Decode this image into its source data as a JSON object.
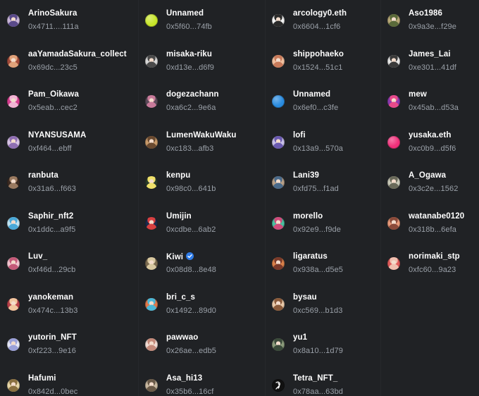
{
  "columns": [
    [
      {
        "name": "ArinoSakura",
        "address": "0x4711....111a",
        "avatar": {
          "icon": "anime-avatar-icon",
          "color": "#c9b6d8",
          "accent": "#5a4a8a"
        }
      },
      {
        "name": "aaYamadaSakura_collect",
        "address": "0x69dc...23c5",
        "avatar": {
          "icon": "anime-avatar-icon",
          "color": "#a14a3a",
          "accent": "#e0a27a"
        }
      },
      {
        "name": "Pam_Oikawa",
        "address": "0x5eab...cec2",
        "avatar": {
          "icon": "anime-avatar-icon",
          "color": "#d63c8f",
          "accent": "#f2b4d4"
        }
      },
      {
        "name": "NYANSUSAMA",
        "address": "0xf464...ebff",
        "avatar": {
          "icon": "anime-avatar-icon",
          "color": "#d8c4e6",
          "accent": "#8f6fb2"
        }
      },
      {
        "name": "ranbuta",
        "address": "0x31a6...f663",
        "avatar": {
          "icon": "anime-avatar-icon",
          "color": "#3a2a22",
          "accent": "#9a7a60"
        }
      },
      {
        "name": "Saphir_nft2",
        "address": "0x1ddc...a9f5",
        "avatar": {
          "icon": "anime-avatar-icon",
          "color": "#bfe4f4",
          "accent": "#4aa8d8"
        }
      },
      {
        "name": "Luv_",
        "address": "0xf46d...29cb",
        "avatar": {
          "icon": "anime-avatar-icon",
          "color": "#f2c4cf",
          "accent": "#c45a78"
        }
      },
      {
        "name": "yanokeman",
        "address": "0x474c...13b3",
        "avatar": {
          "icon": "anime-avatar-icon",
          "color": "#b8404a",
          "accent": "#f1c7a0"
        }
      },
      {
        "name": "yutorin_NFT",
        "address": "0xf223...9e16",
        "avatar": {
          "icon": "anime-avatar-icon",
          "color": "#e6e8f8",
          "accent": "#9aa0d8"
        }
      },
      {
        "name": "Hafumi",
        "address": "0x842d...0bec",
        "avatar": {
          "icon": "anime-avatar-icon",
          "color": "#e8d7a8",
          "accent": "#8a7040"
        }
      }
    ],
    [
      {
        "name": "Unnamed",
        "address": "0x5f60...74fb",
        "avatar": {
          "icon": "default-avatar-icon",
          "color": "#c8e62a",
          "accent": "#a7c81c"
        }
      },
      {
        "name": "misaka-riku",
        "address": "0xd13e...d6f9",
        "avatar": {
          "icon": "anime-avatar-icon",
          "color": "#d8d8d8",
          "accent": "#4a4a4a"
        }
      },
      {
        "name": "dogezachann",
        "address": "0xa6c2...9e6a",
        "avatar": {
          "icon": "anime-avatar-icon",
          "color": "#5a4a58",
          "accent": "#c87a9a"
        }
      },
      {
        "name": "LumenWakuWaku",
        "address": "0xc183...afb3",
        "avatar": {
          "icon": "anime-avatar-icon",
          "color": "#c89a6a",
          "accent": "#6a4a30"
        }
      },
      {
        "name": "kenpu",
        "address": "0x98c0...641b",
        "avatar": {
          "icon": "anime-avatar-icon",
          "color": "#2a3a2a",
          "accent": "#f0e06a"
        }
      },
      {
        "name": "Umijin",
        "address": "0xcdbe...6ab2",
        "avatar": {
          "icon": "anime-avatar-icon",
          "color": "#1a2a4a",
          "accent": "#d84040"
        }
      },
      {
        "name": "Kiwi",
        "address": "0x08d8...8e48",
        "verified": true,
        "avatar": {
          "icon": "anime-avatar-icon",
          "color": "#7a6a50",
          "accent": "#d8c8a0"
        }
      },
      {
        "name": "bri_c_s",
        "address": "0x1492...89d0",
        "avatar": {
          "icon": "anime-avatar-icon",
          "color": "#e0784a",
          "accent": "#4ab8d8"
        }
      },
      {
        "name": "pawwao",
        "address": "0x26ae...edb5",
        "avatar": {
          "icon": "anime-avatar-icon",
          "color": "#f0dcd4",
          "accent": "#c48a7a"
        }
      },
      {
        "name": "Asa_hi13",
        "address": "0x35b6...16cf",
        "avatar": {
          "icon": "anime-avatar-icon",
          "color": "#c8b8a0",
          "accent": "#6a5a48"
        }
      }
    ],
    [
      {
        "name": "arcology0.eth",
        "address": "0x6604...1cf6",
        "avatar": {
          "icon": "anime-avatar-icon",
          "color": "#f2f2f2",
          "accent": "#2a2a2a"
        }
      },
      {
        "name": "shippohaeko",
        "address": "0x1524...51c1",
        "avatar": {
          "icon": "anime-avatar-icon",
          "color": "#f0c0a0",
          "accent": "#c87a5a"
        }
      },
      {
        "name": "Unnamed",
        "address": "0x6ef0...c3fe",
        "avatar": {
          "icon": "default-avatar-icon",
          "color": "#2a8ce0",
          "accent": "#1f74c4"
        }
      },
      {
        "name": "lofi",
        "address": "0x13a9...570a",
        "avatar": {
          "icon": "anime-avatar-icon",
          "color": "#c8c0e8",
          "accent": "#6a5ab0"
        }
      },
      {
        "name": "Lani39",
        "address": "0xfd75...f1ad",
        "avatar": {
          "icon": "anime-avatar-icon",
          "color": "#b8a088",
          "accent": "#4a6a8a"
        }
      },
      {
        "name": "morello",
        "address": "0x92e9...f9de",
        "avatar": {
          "icon": "anime-avatar-icon",
          "color": "#4ac0a0",
          "accent": "#d04a7a"
        }
      },
      {
        "name": "ligaratus",
        "address": "0x938a...d5e5",
        "avatar": {
          "icon": "anime-avatar-icon",
          "color": "#d8804a",
          "accent": "#7a3a2a"
        }
      },
      {
        "name": "bysau",
        "address": "0xc569...b1d3",
        "avatar": {
          "icon": "anime-avatar-icon",
          "color": "#e8c8a8",
          "accent": "#8a5a3a"
        }
      },
      {
        "name": "yu1",
        "address": "0x8a10...1d79",
        "avatar": {
          "icon": "anime-avatar-icon",
          "color": "#8a9a7a",
          "accent": "#3a4a3a"
        }
      },
      {
        "name": "Tetra_NFT_",
        "address": "0x78aa...63bd",
        "avatar": {
          "icon": "tetra-logo-icon",
          "color": "#111111",
          "accent": "#ffffff"
        }
      }
    ],
    [
      {
        "name": "Aso1986",
        "address": "0x9a3e...f29e",
        "avatar": {
          "icon": "anime-avatar-icon",
          "color": "#b8a878",
          "accent": "#5a6a3a"
        }
      },
      {
        "name": "James_Lai",
        "address": "0xe301...41df",
        "avatar": {
          "icon": "anime-avatar-icon",
          "color": "#e8e8e8",
          "accent": "#3a3a3a"
        }
      },
      {
        "name": "mew",
        "address": "0x45ab...d53a",
        "avatar": {
          "icon": "anime-avatar-icon",
          "color": "#8a3ab0",
          "accent": "#e84a8a"
        }
      },
      {
        "name": "yusaka.eth",
        "address": "0xc0b9...d5f6",
        "avatar": {
          "icon": "default-avatar-icon",
          "color": "#f0307a",
          "accent": "#d01a62"
        }
      },
      {
        "name": "A_Ogawa",
        "address": "0x3c2e...1562",
        "avatar": {
          "icon": "anime-avatar-icon",
          "color": "#c8c8b8",
          "accent": "#6a6a5a"
        }
      },
      {
        "name": "watanabe0120",
        "address": "0x318b...6efa",
        "avatar": {
          "icon": "anime-avatar-icon",
          "color": "#e89a7a",
          "accent": "#8a4a3a"
        }
      },
      {
        "name": "norimaki_stp",
        "address": "0xfc60...9a23",
        "avatar": {
          "icon": "anime-avatar-icon",
          "color": "#e05a5a",
          "accent": "#f0c0b0"
        }
      }
    ]
  ]
}
